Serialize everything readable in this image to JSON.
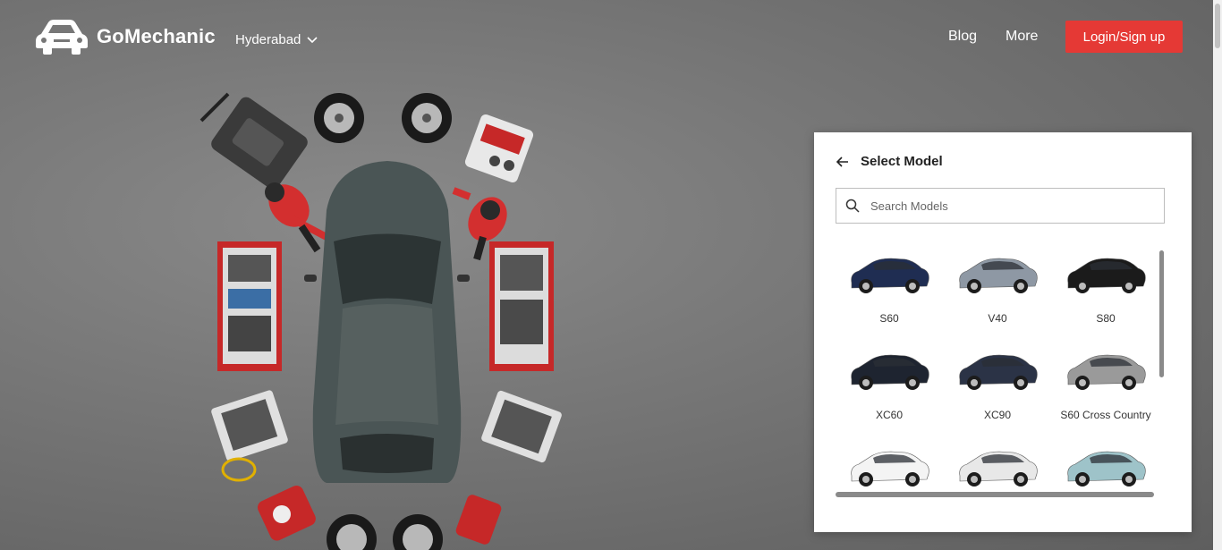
{
  "header": {
    "brand": "GoMechanic",
    "city": "Hyderabad",
    "nav": {
      "blog": "Blog",
      "more": "More"
    },
    "login_label": "Login/Sign up"
  },
  "panel": {
    "title": "Select Model",
    "search_placeholder": "Search Models",
    "models": [
      {
        "name": "S60",
        "color": "#1f2d52"
      },
      {
        "name": "V40",
        "color": "#8e98a4"
      },
      {
        "name": "S80",
        "color": "#1b1b1b"
      },
      {
        "name": "XC60",
        "color": "#1e2430"
      },
      {
        "name": "XC90",
        "color": "#2b3346"
      },
      {
        "name": "S60 Cross Country",
        "color": "#9a9a9a"
      },
      {
        "name": "",
        "color": "#f4f4f4"
      },
      {
        "name": "",
        "color": "#e8e8e8"
      },
      {
        "name": "",
        "color": "#9ec3c9"
      }
    ]
  },
  "colors": {
    "accent": "#e53935"
  }
}
